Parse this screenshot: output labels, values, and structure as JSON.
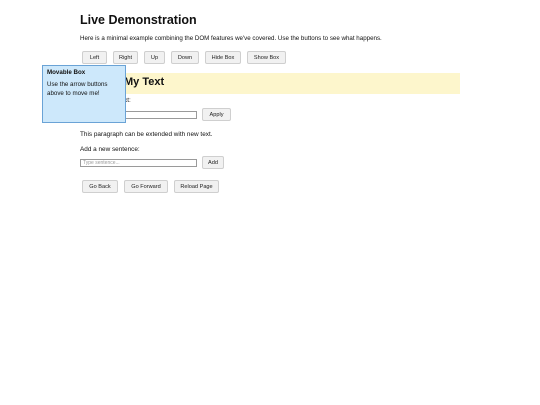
{
  "page": {
    "title": "Live Demonstration",
    "intro": "Here is a minimal example combining the DOM features we've covered. Use the buttons to see what happens."
  },
  "controls": {
    "left": "Left",
    "right": "Right",
    "up": "Up",
    "down": "Down",
    "hide_box": "Hide Box",
    "show_box": "Show Box"
  },
  "heading": {
    "text": "My Text"
  },
  "change_text": {
    "label": "xt:",
    "input_value": "",
    "input_placeholder": "...",
    "apply_label": "Apply"
  },
  "paragraph": {
    "text": "This paragraph can be extended with new text."
  },
  "add_sentence": {
    "label": "Add a new sentence:",
    "input_placeholder": "Type sentence...",
    "add_label": "Add"
  },
  "history": {
    "back": "Go Back",
    "forward": "Go Forward",
    "reload": "Reload Page"
  },
  "movable_box": {
    "title": "Movable Box",
    "text": "Use the arrow buttons above to move me!"
  }
}
